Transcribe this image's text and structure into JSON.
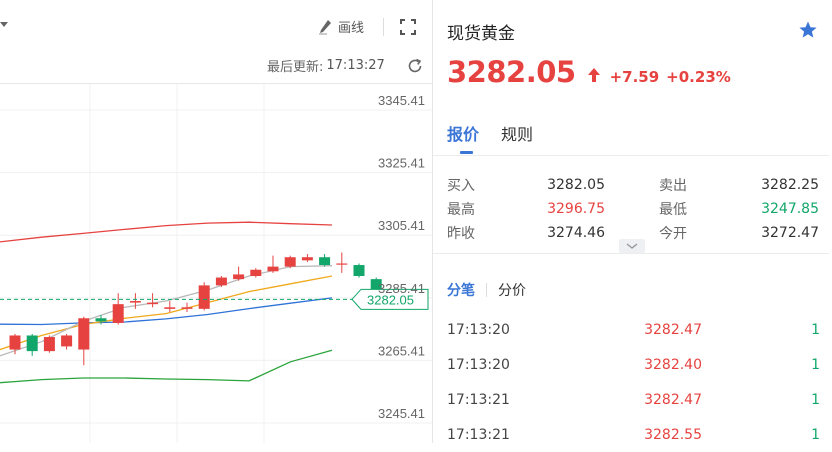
{
  "toolbar": {
    "draw_label": "画线",
    "last_update_label": "最后更新:",
    "last_update_time": "17:13:27"
  },
  "chart": {
    "current_price_label": "3282.05",
    "y_ticks": [
      "3345.41",
      "3325.41",
      "3305.41",
      "3285.41",
      "3265.41",
      "3245.41"
    ]
  },
  "chart_data": {
    "type": "candlestick",
    "ylim": [
      3245.41,
      3345.41
    ],
    "y_ticks": [
      3345.41,
      3325.41,
      3305.41,
      3285.41,
      3265.41,
      3245.41
    ],
    "current_price": 3282.05,
    "candles": [
      {
        "o": 3266.0,
        "c": 3270.5,
        "h": 3271.0,
        "l": 3264.5
      },
      {
        "o": 3270.5,
        "c": 3265.5,
        "h": 3271.0,
        "l": 3264.0
      },
      {
        "o": 3265.5,
        "c": 3270.0,
        "h": 3270.5,
        "l": 3265.0
      },
      {
        "o": 3267.0,
        "c": 3270.5,
        "h": 3271.0,
        "l": 3266.0
      },
      {
        "o": 3266.0,
        "c": 3276.0,
        "h": 3276.5,
        "l": 3261.0
      },
      {
        "o": 3276.0,
        "c": 3275.0,
        "h": 3277.0,
        "l": 3274.0
      },
      {
        "o": 3274.5,
        "c": 3280.5,
        "h": 3284.0,
        "l": 3274.0
      },
      {
        "o": 3281.0,
        "c": 3281.5,
        "h": 3284.0,
        "l": 3279.0
      },
      {
        "o": 3280.5,
        "c": 3281.0,
        "h": 3284.0,
        "l": 3279.5
      },
      {
        "o": 3279.0,
        "c": 3279.5,
        "h": 3281.5,
        "l": 3278.0
      },
      {
        "o": 3279.0,
        "c": 3279.5,
        "h": 3281.0,
        "l": 3278.0
      },
      {
        "o": 3279.0,
        "c": 3286.5,
        "h": 3287.5,
        "l": 3278.5
      },
      {
        "o": 3286.5,
        "c": 3289.0,
        "h": 3289.5,
        "l": 3286.0
      },
      {
        "o": 3288.5,
        "c": 3290.0,
        "h": 3292.5,
        "l": 3288.0
      },
      {
        "o": 3289.5,
        "c": 3291.5,
        "h": 3292.0,
        "l": 3289.0
      },
      {
        "o": 3291.0,
        "c": 3292.5,
        "h": 3296.0,
        "l": 3290.5
      },
      {
        "o": 3292.5,
        "c": 3295.5,
        "h": 3296.0,
        "l": 3292.0
      },
      {
        "o": 3294.5,
        "c": 3295.5,
        "h": 3296.5,
        "l": 3294.0
      },
      {
        "o": 3295.5,
        "c": 3293.0,
        "h": 3296.5,
        "l": 3292.5
      },
      {
        "o": 3293.5,
        "c": 3293.5,
        "h": 3297.0,
        "l": 3290.5
      },
      {
        "o": 3293.0,
        "c": 3289.5,
        "h": 3293.5,
        "l": 3289.0
      },
      {
        "o": 3288.5,
        "c": 3282.0,
        "h": 3289.0,
        "l": 3281.5
      }
    ],
    "bollinger_upper": [
      3300.4,
      3301.9,
      3303.1,
      3304.4,
      3305.6,
      3306.4,
      3306.7,
      3306.2,
      3305.8
    ],
    "bollinger_mid": [
      3274.1,
      3274.0,
      3274.5,
      3274.8,
      3275.8,
      3277.2,
      3279.1,
      3280.8,
      3282.5
    ],
    "bollinger_lower": [
      3255.4,
      3256.4,
      3256.9,
      3256.9,
      3256.6,
      3256.4,
      3256.0,
      3262.1,
      3265.8
    ],
    "ma_short": [
      3264.0,
      3268.5,
      3275.0,
      3279.5,
      3281.5,
      3285.0,
      3289.5,
      3292.5,
      3292.8
    ],
    "ma_long": [
      3266.0,
      3270.5,
      3274.0,
      3276.0,
      3277.5,
      3281.0,
      3284.5,
      3287.0,
      3289.5
    ]
  },
  "instrument": {
    "name": "现货黄金",
    "price": "3282.05",
    "change": "+7.59",
    "change_pct": "+0.23%"
  },
  "tabs": [
    "报价",
    "规则"
  ],
  "quote": [
    {
      "k1": "买入",
      "v1": "3282.05",
      "k2": "卖出",
      "v2": "3282.25"
    },
    {
      "k1": "最高",
      "v1": "3296.75",
      "k2": "最低",
      "v2": "3247.85"
    },
    {
      "k1": "昨收",
      "v1": "3274.46",
      "k2": "今开",
      "v2": "3272.47"
    }
  ],
  "subtabs": [
    "分笔",
    "分价"
  ],
  "ticks": [
    {
      "time": "17:13:20",
      "price": "3282.47",
      "vol": "1"
    },
    {
      "time": "17:13:20",
      "price": "3282.40",
      "vol": "1"
    },
    {
      "time": "17:13:21",
      "price": "3282.47",
      "vol": "1"
    },
    {
      "time": "17:13:21",
      "price": "3282.55",
      "vol": "1"
    }
  ],
  "colors": {
    "up": "#e64340",
    "down": "#12a66a",
    "accent": "#3b76d6"
  },
  "icons": {
    "draw": "pen-icon",
    "fullscreen": "fullscreen-icon",
    "refresh": "refresh-icon",
    "favorite": "star-icon",
    "change_direction": "arrow-up-icon",
    "expand": "chevron-down-icon"
  }
}
